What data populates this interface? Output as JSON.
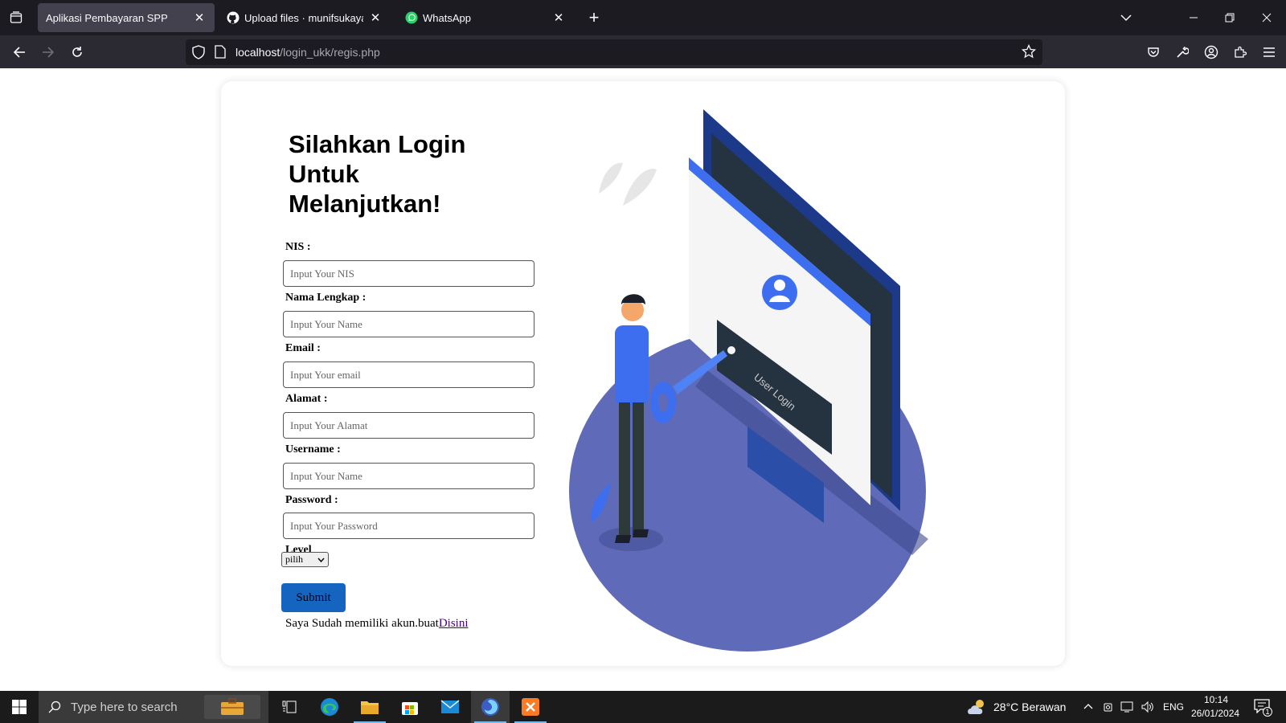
{
  "browser": {
    "tabs": [
      {
        "title": "Aplikasi Pembayaran SPP",
        "active": true
      },
      {
        "title": "Upload files · munifsukayanto/",
        "active": false
      },
      {
        "title": "WhatsApp",
        "active": false
      }
    ],
    "url": {
      "host": "localhost",
      "path": "/login_ukk/regis.php"
    }
  },
  "form": {
    "heading": "Silahkan Login Untuk Melanjutkan!",
    "fields": [
      {
        "label": "NIS :",
        "placeholder": "Input Your NIS"
      },
      {
        "label": "Nama Lengkap :",
        "placeholder": "Input Your Name"
      },
      {
        "label": "Email :",
        "placeholder": "Input Your email"
      },
      {
        "label": "Alamat :",
        "placeholder": "Input Your Alamat"
      },
      {
        "label": "Username :",
        "placeholder": "Input Your Name"
      },
      {
        "label": "Password :",
        "placeholder": "Input Your Password"
      }
    ],
    "level_label": "Level",
    "level_selected": "pilih",
    "submit_label": "Submit",
    "register_text": "Saya Sudah memiliki akun.buat",
    "register_link": "Disini"
  },
  "illustration": {
    "caption": "User Login"
  },
  "taskbar": {
    "search_placeholder": "Type here to search",
    "weather": "28°C  Berawan",
    "language": "ENG",
    "time": "10:14",
    "date": "26/01/2024",
    "notification_count": "1"
  },
  "colors": {
    "accent": "#1565c0",
    "illustration_primary": "#5f6bb8",
    "monitor_blue": "#2b4fa8"
  }
}
